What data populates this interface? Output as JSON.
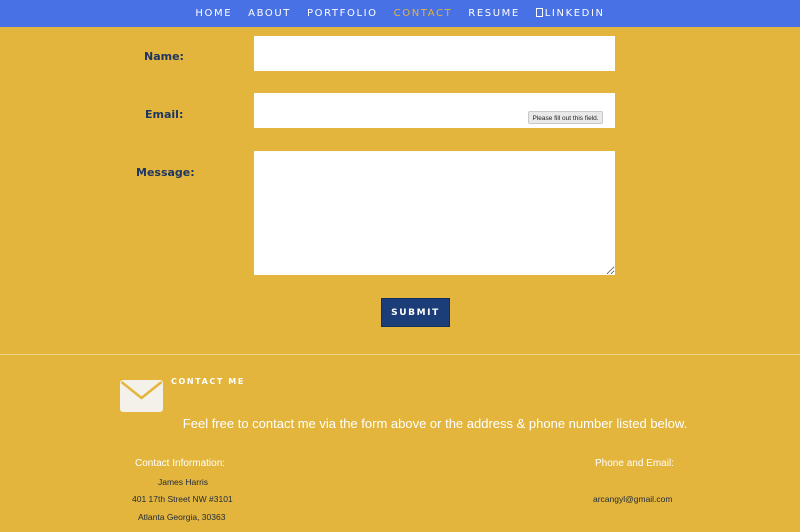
{
  "nav": {
    "items": [
      {
        "label": "HOME"
      },
      {
        "label": "ABOUT"
      },
      {
        "label": "PORTFOLIO"
      },
      {
        "label": "CONTACT"
      },
      {
        "label": "RESUME"
      },
      {
        "label": "LINKEDIN"
      }
    ]
  },
  "form": {
    "name_label": "Name:",
    "email_label": "Email:",
    "message_label": "Message:",
    "name_value": "",
    "email_value": "",
    "message_value": "",
    "validation_tooltip": "Please fill out this field.",
    "submit_label": "SUBMIT"
  },
  "contact": {
    "title": "CONTACT ME",
    "tagline": "Feel free to contact me via the form above or the address & phone number listed below.",
    "info_heading": "Contact Information:",
    "name": "James Harris",
    "address_line1": "401 17th Street NW #3101",
    "address_line2": "Atlanta Georgia, 30363",
    "phone_email_heading": "Phone and Email:",
    "email": "arcangyl@gmail.com"
  },
  "colors": {
    "background": "#e3b53d",
    "nav": "#4871e5",
    "accent": "#e3b53d",
    "label": "#1d3561",
    "button": "#1b3d78"
  }
}
